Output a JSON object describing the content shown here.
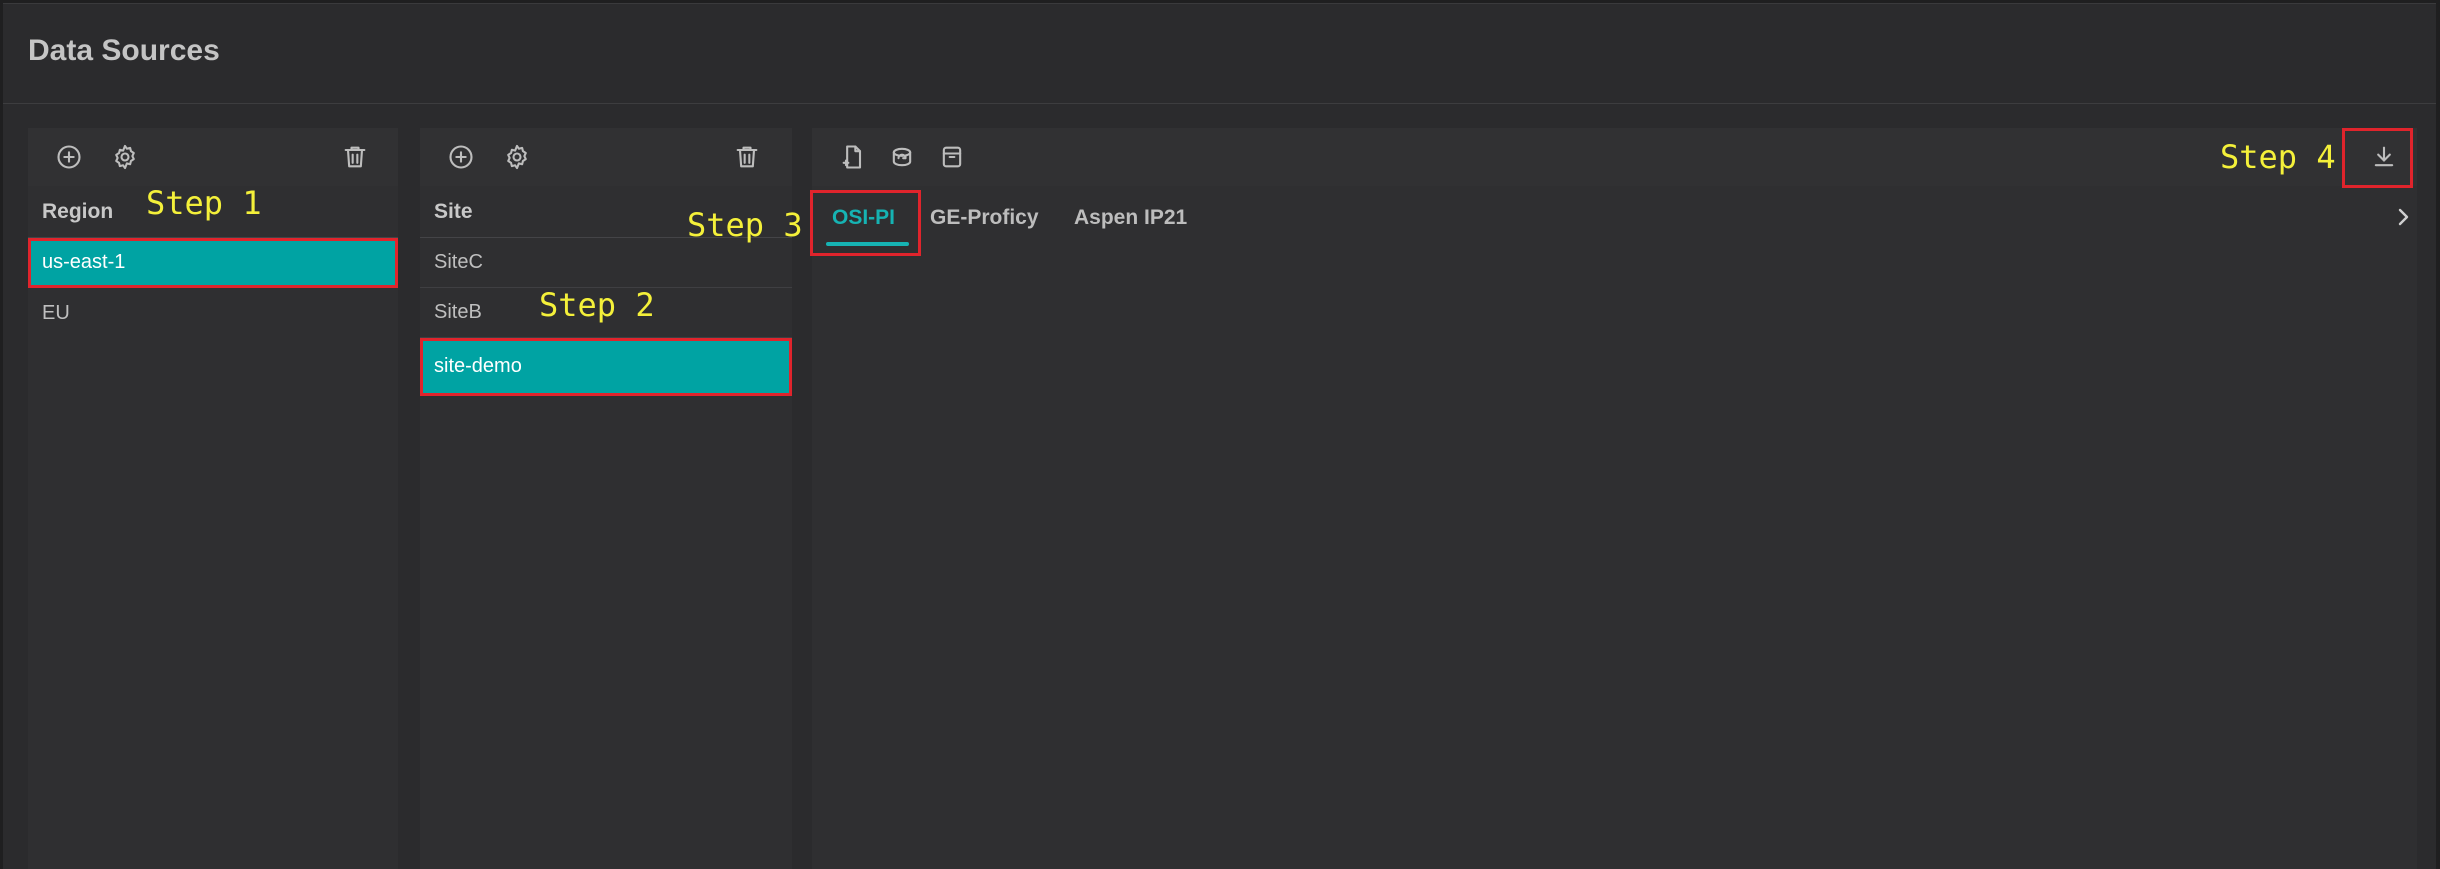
{
  "page": {
    "title": "Data Sources"
  },
  "region_panel": {
    "header": "Region",
    "items": [
      {
        "label": "us-east-1",
        "selected": true
      },
      {
        "label": "EU",
        "selected": false
      }
    ],
    "toolbar": {
      "add": "add-icon",
      "settings": "gear-icon",
      "delete": "trash-icon"
    }
  },
  "site_panel": {
    "header": "Site",
    "items": [
      {
        "label": "SiteC",
        "selected": false
      },
      {
        "label": "SiteB",
        "selected": false
      },
      {
        "label": "site-demo",
        "selected": true
      }
    ],
    "toolbar": {
      "add": "add-icon",
      "settings": "gear-icon",
      "delete": "trash-icon"
    }
  },
  "source_panel": {
    "toolbar": {
      "new_file": "new-file-icon",
      "database_sync": "database-sync-icon",
      "archive": "archive-icon",
      "download": "download-icon"
    },
    "tabs": [
      {
        "label": "OSI-PI",
        "active": true
      },
      {
        "label": "GE-Proficy",
        "active": false
      },
      {
        "label": "Aspen IP21",
        "active": false
      }
    ]
  },
  "annotations": {
    "step1": "Step 1",
    "step2": "Step 2",
    "step3": "Step 3",
    "step4": "Step 4"
  },
  "colors": {
    "accent": "#00a3a3",
    "highlight_box": "#e0242c",
    "annotation": "#f4f03a"
  }
}
